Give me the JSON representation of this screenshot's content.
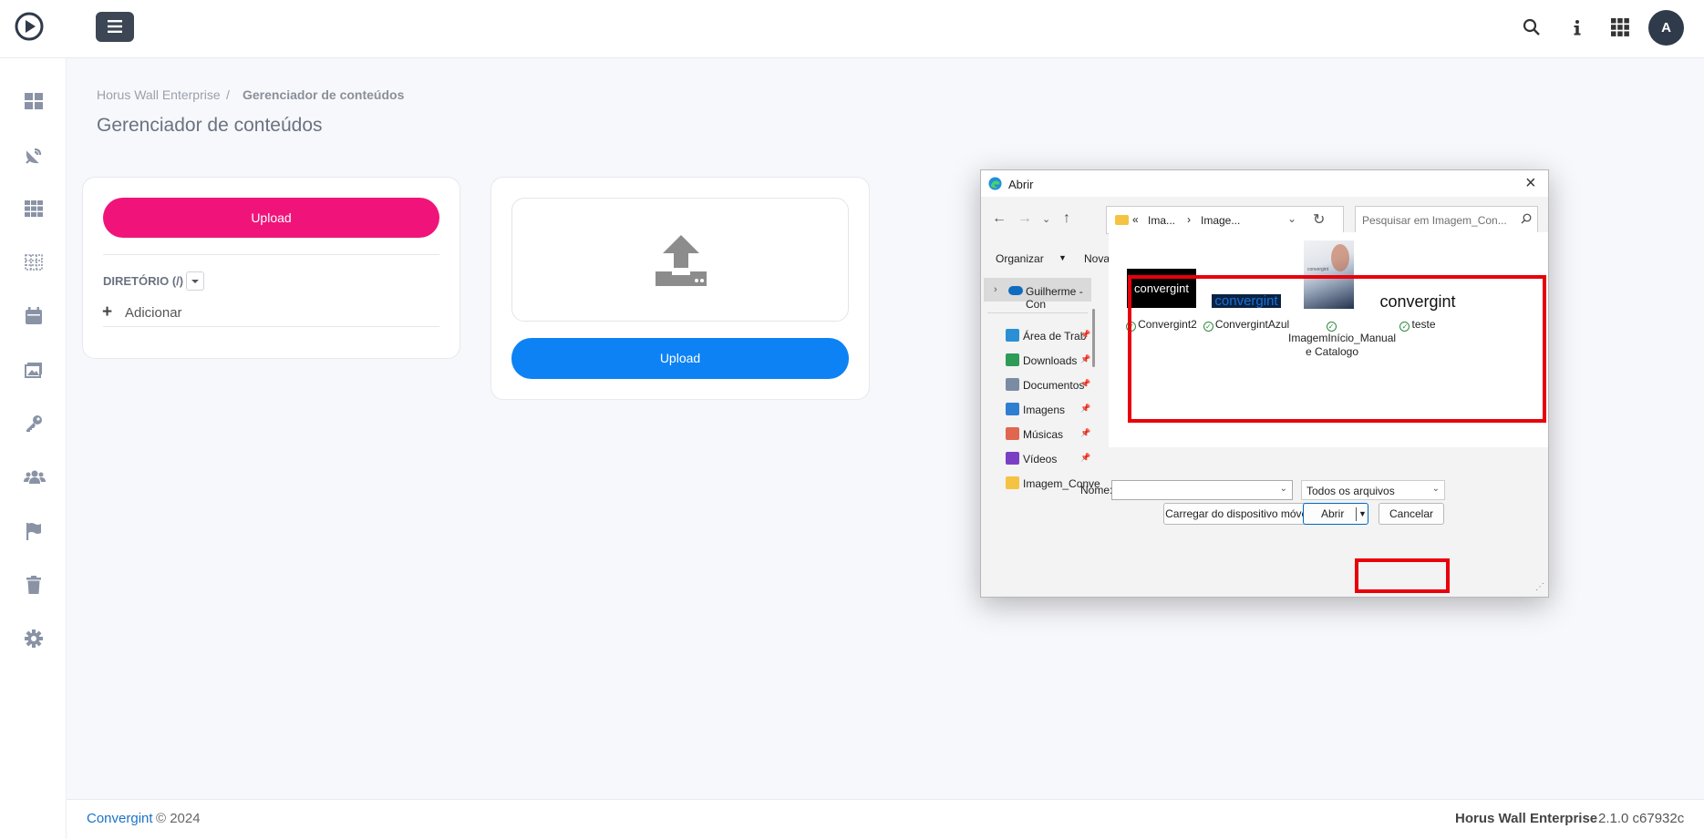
{
  "app": {
    "brand_color": "#f0147a",
    "primary_color": "#0d82f5",
    "sidebar_items": [
      {
        "icon": "dashboard-icon"
      },
      {
        "icon": "satellite-dish-icon"
      },
      {
        "icon": "grid-icon"
      },
      {
        "icon": "dotted-grid-icon"
      },
      {
        "icon": "calendar-icon"
      },
      {
        "icon": "images-icon"
      },
      {
        "icon": "key-icon"
      },
      {
        "icon": "users-icon"
      },
      {
        "icon": "flag-icon"
      },
      {
        "icon": "trash-icon"
      },
      {
        "icon": "gear-icon"
      }
    ],
    "topbar": {
      "icons": [
        "search-icon",
        "info-icon",
        "apps-icon"
      ],
      "avatar": "A"
    },
    "breadcrumb": {
      "root": "Horus Wall Enterprise",
      "separator": "/",
      "current": "Gerenciador de conteúdos"
    },
    "page_title": "Gerenciador de conteúdos",
    "left_card": {
      "upload_label": "Upload",
      "directory_label": "DIRETÓRIO (/)",
      "add_label": "Adicionar"
    },
    "right_card": {
      "upload_label": "Upload"
    },
    "footer": {
      "brand": "Convergint",
      "copyright": "© 2024",
      "product": "Horus Wall Enterprise",
      "version": "2.1.0 c67932c"
    }
  },
  "dialog": {
    "title": "Abrir",
    "address": {
      "prefix": "«",
      "seg1": "Ima...",
      "seg2": "Image..."
    },
    "search_placeholder": "Pesquisar em Imagem_Con...",
    "organize": "Organizar",
    "new_folder": "Nova pasta",
    "help": "?",
    "nav": {
      "top_item": "Guilherme - Con",
      "items": [
        {
          "label": "Área de Traba",
          "color": "#2b8fd6",
          "pinned": true
        },
        {
          "label": "Downloads",
          "color": "#2e9b57",
          "pinned": true
        },
        {
          "label": "Documentos",
          "color": "#7a8ca3",
          "pinned": true
        },
        {
          "label": "Imagens",
          "color": "#2f7fd0",
          "pinned": true
        },
        {
          "label": "Músicas",
          "color": "#e0664f",
          "pinned": true
        },
        {
          "label": "Vídeos",
          "color": "#7b3fc4",
          "pinned": true
        },
        {
          "label": "Imagem_Conve",
          "color": "#f5c342",
          "pinned": false
        }
      ]
    },
    "files": [
      {
        "name": "Convergint2",
        "thumb_text": "convergint"
      },
      {
        "name": "ConvergintAzul",
        "thumb_text": "convergint"
      },
      {
        "name": "ImagemInício_Manual e Catalogo",
        "thumb_text": "convergint"
      },
      {
        "name": "teste",
        "thumb_text": "convergint"
      }
    ],
    "name_label": "Nome:",
    "name_value": "",
    "filter": "Todos os arquivos",
    "buttons": {
      "mobile": "Carregar do dispositivo móvel",
      "open": "Abrir",
      "cancel": "Cancelar"
    },
    "highlight_color": "#e8000b"
  }
}
